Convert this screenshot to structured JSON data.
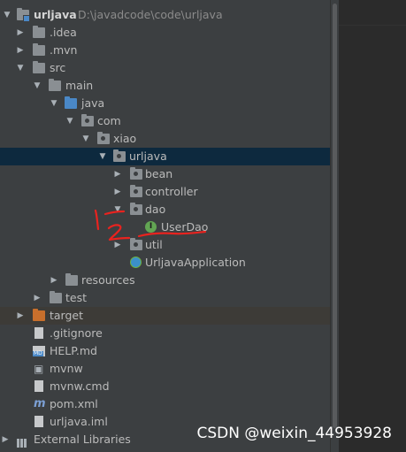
{
  "project_tree": {
    "root": {
      "label": "urljava",
      "path": "D:\\javadcode\\code\\urljava"
    },
    "items": [
      {
        "label": ".idea"
      },
      {
        "label": ".mvn"
      },
      {
        "label": "src"
      },
      {
        "label": "main"
      },
      {
        "label": "java"
      },
      {
        "label": "com"
      },
      {
        "label": "xiao"
      },
      {
        "label": "urljava"
      },
      {
        "label": "bean"
      },
      {
        "label": "controller"
      },
      {
        "label": "dao"
      },
      {
        "label": "UserDao"
      },
      {
        "label": "util"
      },
      {
        "label": "UrljavaApplication"
      },
      {
        "label": "resources"
      },
      {
        "label": "test"
      },
      {
        "label": "target"
      },
      {
        "label": ".gitignore"
      },
      {
        "label": "HELP.md"
      },
      {
        "label": "mvnw"
      },
      {
        "label": "mvnw.cmd"
      },
      {
        "label": "pom.xml"
      },
      {
        "label": "urljava.iml"
      },
      {
        "label": "External Libraries"
      }
    ]
  },
  "icons": {
    "expanded": "chevron-down-icon",
    "collapsed": "chevron-right-icon",
    "folder": "folder-icon",
    "source_folder": "source-folder-icon",
    "package": "package-icon",
    "interface": "interface-icon",
    "interface_glyph": "I",
    "application": "spring-boot-app-icon",
    "excluded_folder": "excluded-folder-icon",
    "text_file": "text-file-icon",
    "markdown": "markdown-file-icon",
    "maven": "maven-icon",
    "maven_glyph": "m",
    "libraries": "libraries-icon"
  },
  "annotations": {
    "mark_one": "1",
    "mark_two": "2",
    "color": "#e8231f"
  },
  "colors": {
    "panel_bg": "#3c3f41",
    "selected_row": "#0d293e",
    "excluded_row": "#3d3b37",
    "source_folder": "#4a88c7",
    "excluded_folder": "#c86f2c",
    "interface_badge": "#62a553"
  },
  "watermark": "CSDN @weixin_44953928"
}
